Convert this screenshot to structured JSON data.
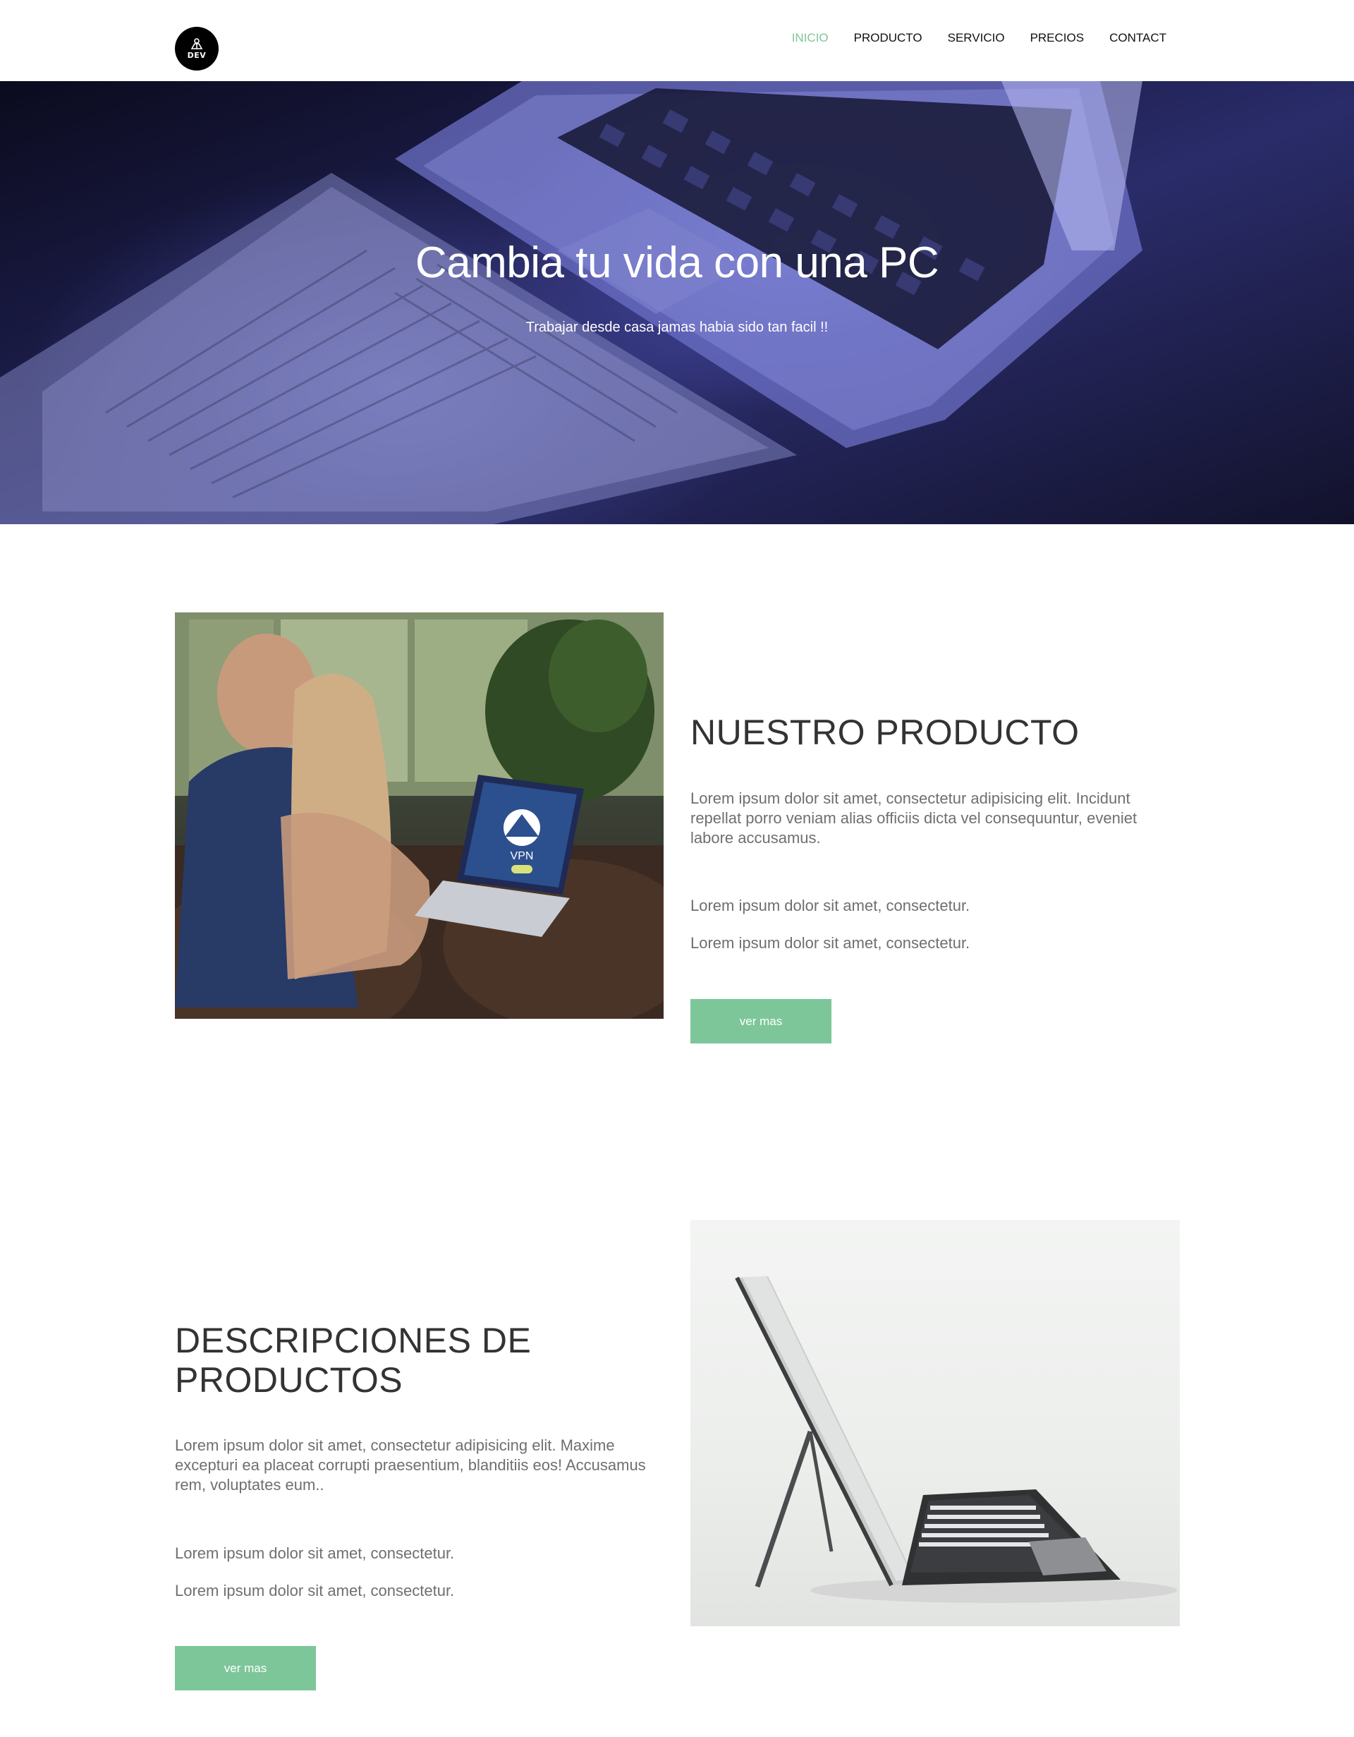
{
  "header": {
    "logo_text": "DEV",
    "nav": [
      {
        "label": "INICIO",
        "active": true
      },
      {
        "label": "PRODUCTO",
        "active": false
      },
      {
        "label": "SERVICIO",
        "active": false
      },
      {
        "label": "PRECIOS",
        "active": false
      },
      {
        "label": "CONTACT",
        "active": false
      }
    ]
  },
  "hero": {
    "title": "Cambia tu vida con una PC",
    "subtitle": "Trabajar desde casa jamas habia sido tan facil !!"
  },
  "section1": {
    "title": "NUESTRO PRODUCTO",
    "paragraph": "Lorem ipsum dolor sit amet, consectetur adipisicing elit. Incidunt repellat porro veniam alias officiis dicta vel consequuntur, eveniet labore accusamus.",
    "line1": "Lorem ipsum dolor sit amet, consectetur.",
    "line2": "Lorem ipsum dolor sit amet, consectetur.",
    "button": "ver mas",
    "photo_vpn_label": "VPN"
  },
  "section2": {
    "title_line1": "DESCRIPCIONES DE",
    "title_line2": "PRODUCTOS",
    "paragraph": "Lorem ipsum dolor sit amet, consectetur adipisicing elit. Maxime excepturi ea placeat corrupti praesentium, blanditiis eos! Accusamus rem, voluptates eum..",
    "line1": "Lorem ipsum dolor sit amet, consectetur.",
    "line2": "Lorem ipsum dolor sit amet, consectetur.",
    "button": "ver mas"
  },
  "colors": {
    "accent": "#7dc69a",
    "text_dark": "#333333",
    "text_muted": "#6f6f6f"
  }
}
